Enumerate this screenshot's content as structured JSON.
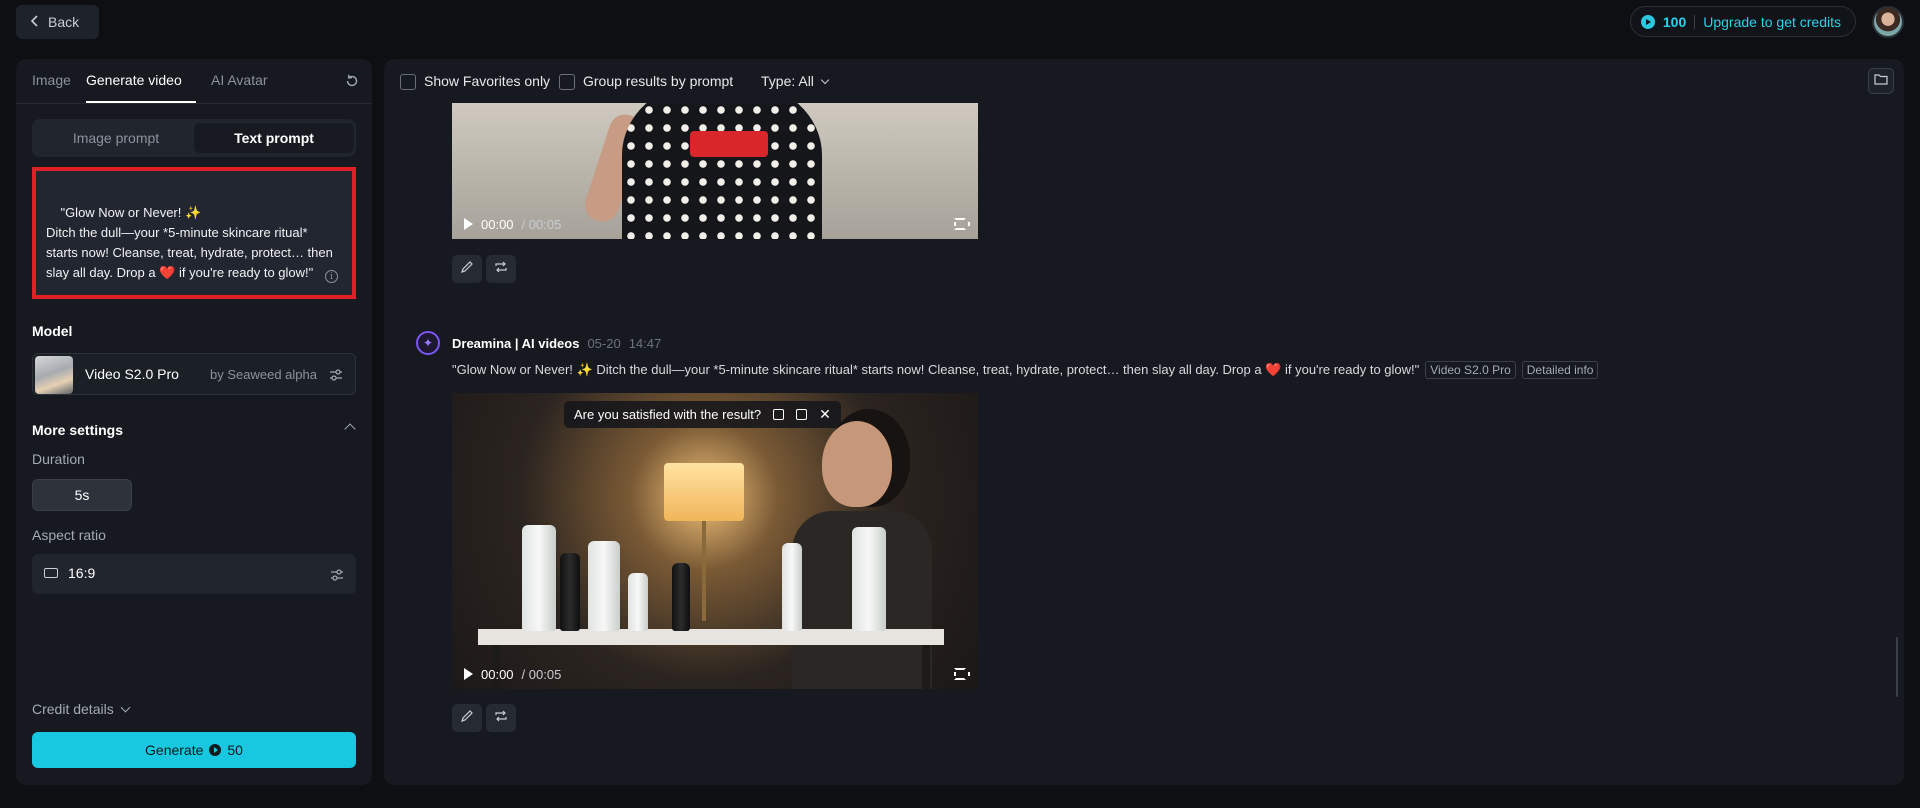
{
  "topbar": {
    "back_label": "Back",
    "credits": "100",
    "upgrade_label": "Upgrade to get credits"
  },
  "left": {
    "tabs": [
      "Image",
      "Generate video",
      "AI Avatar"
    ],
    "active_tab": "Generate video",
    "prompt_modes": [
      "Image prompt",
      "Text prompt"
    ],
    "active_prompt_mode": "Text prompt",
    "prompt_text": "\"Glow Now or Never! ✨\nDitch the dull—your *5-minute skincare ritual* starts now! Cleanse, treat, hydrate, protect… then slay all day. Drop a ❤️ if you're ready to glow!\"",
    "model_label": "Model",
    "model_name": "Video S2.0 Pro",
    "model_by": "by Seaweed alpha",
    "more_settings_label": "More settings",
    "duration_label": "Duration",
    "duration_value": "5s",
    "aspect_label": "Aspect ratio",
    "aspect_value": "16:9",
    "credit_details_label": "Credit details",
    "generate_label": "Generate",
    "generate_cost": "50"
  },
  "main": {
    "filters": {
      "show_favorites": "Show Favorites only",
      "group_results": "Group results by prompt",
      "type": "Type: All"
    },
    "videos": [
      {
        "current_time": "00:00",
        "total_time": "/ 00:05"
      },
      {
        "current_time": "00:00",
        "total_time": "/ 00:05"
      }
    ],
    "generation": {
      "author": "Dreamina | AI videos",
      "date": "05-20",
      "time": "14:47",
      "prompt": "\"Glow Now or Never! ✨ Ditch the dull—your *5-minute skincare ritual* starts now! Cleanse, treat, hydrate, protect… then slay all day. Drop a ❤️ if you're ready to glow!\"",
      "model_tag": "Video S2.0 Pro",
      "detail_tag": "Detailed info",
      "feedback_question": "Are you satisfied with the result?"
    }
  },
  "colors": {
    "accent": "#18c8e0",
    "highlight_border": "#e01f26",
    "panel": "#16191f",
    "background": "#0d0f13"
  }
}
